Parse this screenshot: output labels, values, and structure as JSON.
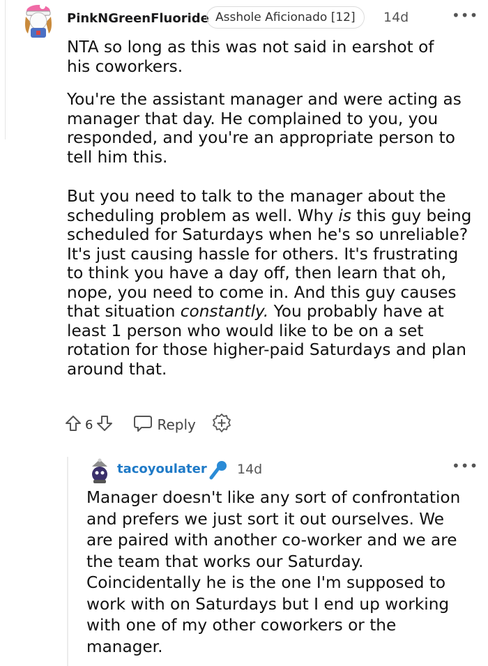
{
  "top_comment": {
    "username": "PinkNGreenFluoride",
    "flair": "Asshole Aficionado [12]",
    "time": "14d",
    "more": "•••",
    "paragraphs": [
      [
        "NTA so long as this was not said in earshot of",
        "his coworkers."
      ],
      [
        "You're the assistant manager and were acting as",
        "manager that day. He complained to you, you",
        "responded, and you're an appropriate person to",
        "tell him this."
      ]
    ],
    "para3": {
      "l1": "But you need to talk to the manager about the",
      "l2": "scheduling problem as well. Why ",
      "l2_em": "is",
      "l2_rest": " this guy being",
      "l3": "scheduled for Saturdays when he's so unreliable?",
      "l4": "It's just causing hassle for others. It's frustrating",
      "l5": "to think you have a day off, then learn that oh,",
      "l6": "nope, you need to come in. And this guy causes",
      "l7": "that situation ",
      "l7_em": "constantly.",
      "l7_rest": " You probably have at",
      "l8": "least 1 person who would like to be on a set",
      "l9": "rotation for those higher-paid Saturdays and plan",
      "l10": "around that."
    },
    "vote_count": "6",
    "reply_label": "Reply"
  },
  "reply_comment": {
    "username": "tacoyoulater",
    "time": "14d",
    "more": "•••",
    "lines": [
      "Manager doesn't like any sort of confrontation",
      "and prefers we just sort it out ourselves. We",
      "are paired with another co-worker and we are",
      "the team that works our Saturday.",
      "Coincidentally he is the one I'm supposed to",
      "work with on Saturdays but I end up working",
      "with one of my other coworkers or the",
      "manager."
    ]
  },
  "icons": {
    "upvote": "upvote-arrow-icon",
    "downvote": "downvote-arrow-icon",
    "reply": "speech-bubble-icon",
    "award": "award-plus-icon",
    "mic": "microphone-icon"
  },
  "colors": {
    "username_reply": "#1f7ac7",
    "mic": "#2a8bd6",
    "text": "#111111",
    "meta": "#555555"
  }
}
